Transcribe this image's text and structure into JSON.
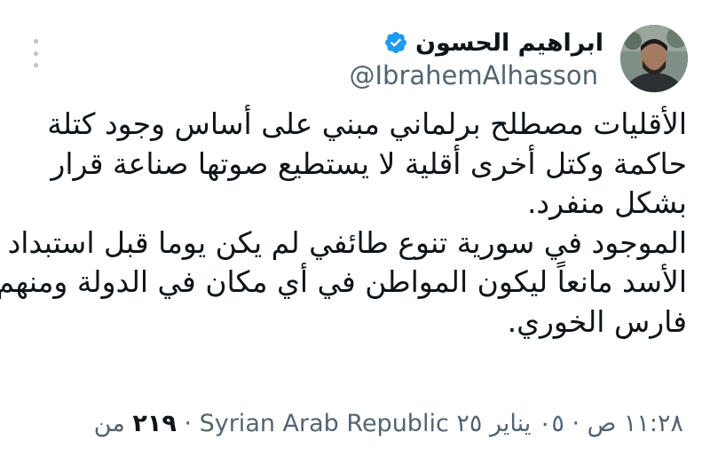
{
  "author": {
    "display_name": "ابراهيم الحسون",
    "handle": "@IbrahemAlhasson",
    "verified_color": "#1d9bf0"
  },
  "tweet": {
    "lines": [
      "الأقليات مصطلح برلماني مبني على أساس وجود كتلة",
      "حاكمة وكتل أخرى أقلية لا يستطيع صوتها صناعة قرار",
      "بشكل منفرد.",
      "الموجود في سورية تنوع طائفي لم يكن يوما قبل استبداد",
      "الأسد مانعاً ليكون المواطن في أي مكان في الدولة  ومنهم",
      "فارس الخوري."
    ]
  },
  "meta": {
    "time": "١١:٢٨ ص",
    "date": "٠٥ يناير ٢٥",
    "location": "Syrian Arab Republic",
    "views_number": "٢١٩",
    "views_prefix": "من"
  },
  "icons": {
    "more": "more-vertical-icon",
    "verified": "verified-badge-icon"
  }
}
